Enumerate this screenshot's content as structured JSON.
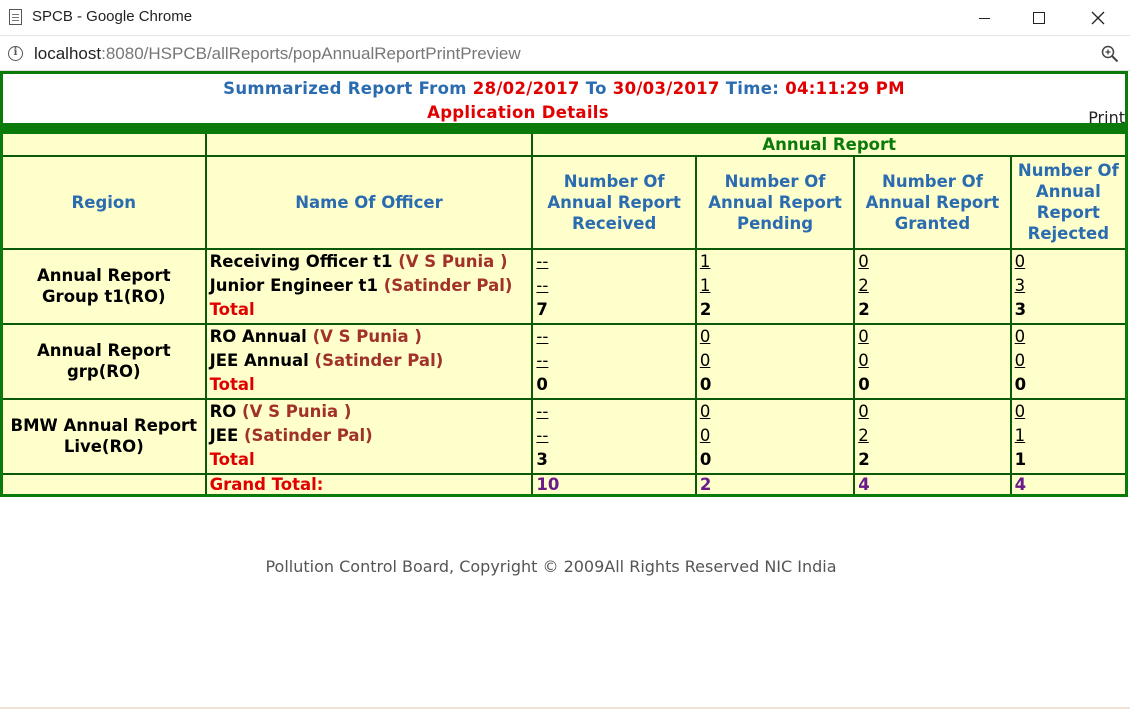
{
  "window": {
    "title": "SPCB - Google Chrome",
    "url_host": "localhost",
    "url_path": ":8080/HSPCB/allReports/popAnnualReportPrintPreview"
  },
  "report": {
    "summary_prefix": "Summarized Report From",
    "from_date": "28/02/2017",
    "to_label": "To",
    "to_date": "30/03/2017",
    "time_label": "Time:",
    "time": "04:11:29 PM",
    "subtitle": "Application Details",
    "print_label": "Print",
    "group_header": "Annual Report",
    "columns": {
      "region": "Region",
      "officer": "Name Of Officer",
      "received": "Number Of Annual Report Received",
      "pending": "Number Of Annual Report Pending",
      "granted": "Number Of Annual Report Granted",
      "rejected": "Number Of Annual Report Rejected"
    },
    "groups": [
      {
        "region": "Annual Report Group t1(RO)",
        "officers": [
          {
            "role": "Receiving Officer t1",
            "name": "(V S Punia )",
            "received": "--",
            "pending": "1",
            "granted": "0",
            "rejected": "0"
          },
          {
            "role": "Junior Engineer t1",
            "name": "(Satinder Pal)",
            "received": "--",
            "pending": "1",
            "granted": "2",
            "rejected": "3"
          }
        ],
        "total_label": "Total",
        "total": {
          "received": "7",
          "pending": "2",
          "granted": "2",
          "rejected": "3"
        }
      },
      {
        "region": "Annual Report grp(RO)",
        "officers": [
          {
            "role": "RO Annual",
            "name": "(V S Punia )",
            "received": "--",
            "pending": "0",
            "granted": "0",
            "rejected": "0"
          },
          {
            "role": "JEE Annual",
            "name": "(Satinder Pal)",
            "received": "--",
            "pending": "0",
            "granted": "0",
            "rejected": "0"
          }
        ],
        "total_label": "Total",
        "total": {
          "received": "0",
          "pending": "0",
          "granted": "0",
          "rejected": "0"
        }
      },
      {
        "region": "BMW Annual Report Live(RO)",
        "officers": [
          {
            "role": "RO",
            "name": "(V S Punia )",
            "received": "--",
            "pending": "0",
            "granted": "0",
            "rejected": "0"
          },
          {
            "role": "JEE",
            "name": "(Satinder Pal)",
            "received": "--",
            "pending": "0",
            "granted": "2",
            "rejected": "1"
          }
        ],
        "total_label": "Total",
        "total": {
          "received": "3",
          "pending": "0",
          "granted": "2",
          "rejected": "1"
        }
      }
    ],
    "grand_total_label": "Grand Total:",
    "grand_total": {
      "received": "10",
      "pending": "2",
      "granted": "4",
      "rejected": "4"
    },
    "footer": "Pollution Control Board, Copyright © 2009All Rights Reserved NIC India"
  },
  "colors": {
    "border_green": "#0a7a0a",
    "header_blue": "#2b6cb0",
    "accent_red": "#e00000",
    "cell_bg": "#ffffcc",
    "grand_total_purple": "#6a1a8a"
  },
  "icons": [
    "page-icon",
    "info-icon",
    "zoom-icon",
    "minimize-icon",
    "maximize-icon",
    "close-icon"
  ]
}
